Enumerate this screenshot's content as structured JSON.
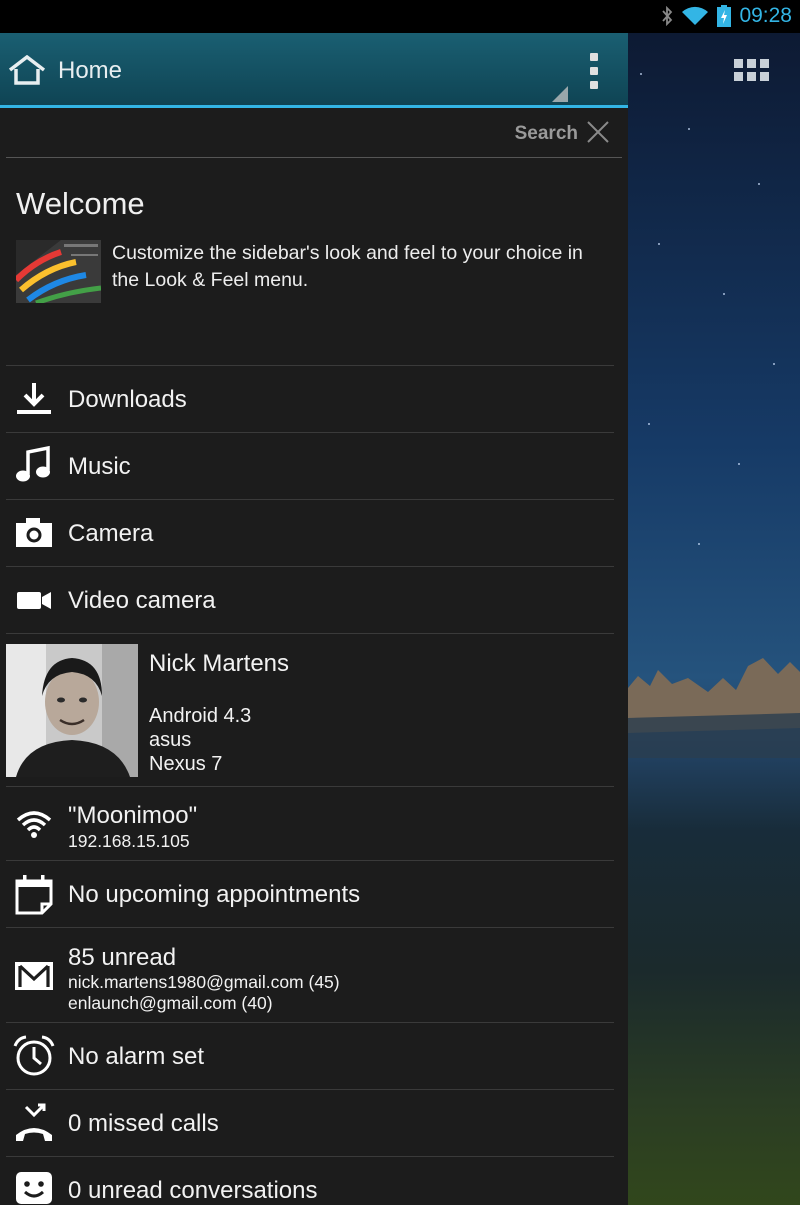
{
  "status_bar": {
    "time": "09:28",
    "icons": [
      "bluetooth-icon",
      "wifi-signal-icon",
      "battery-charging-icon"
    ],
    "clock_color": "#33b5e5"
  },
  "header": {
    "title": "Home",
    "icon": "home-icon"
  },
  "search": {
    "label": "Search"
  },
  "welcome": {
    "title": "Welcome",
    "text": "Customize the sidebar's look and feel to your choice in the Look & Feel menu."
  },
  "shortcuts": [
    {
      "label": "Downloads",
      "icon": "download-icon"
    },
    {
      "label": "Music",
      "icon": "music-note-icon"
    },
    {
      "label": "Camera",
      "icon": "camera-icon"
    },
    {
      "label": "Video camera",
      "icon": "video-camera-icon"
    }
  ],
  "profile": {
    "name": "Nick Martens",
    "os": "Android 4.3",
    "manufacturer": "asus",
    "model": "Nexus 7"
  },
  "wifi": {
    "ssid": "\"Moonimoo\"",
    "ip": "192.168.15.105"
  },
  "calendar": {
    "label": "No upcoming appointments"
  },
  "gmail": {
    "label": "85 unread",
    "account1": "nick.martens1980@gmail.com (45)",
    "account2": "enlaunch@gmail.com (40)"
  },
  "alarm": {
    "label": "No alarm set"
  },
  "calls": {
    "label": "0 missed calls"
  },
  "messages": {
    "label": "0 unread conversations"
  },
  "colors": {
    "accent": "#33b5e5",
    "header": "#15586a",
    "background": "#1c1c1c"
  }
}
